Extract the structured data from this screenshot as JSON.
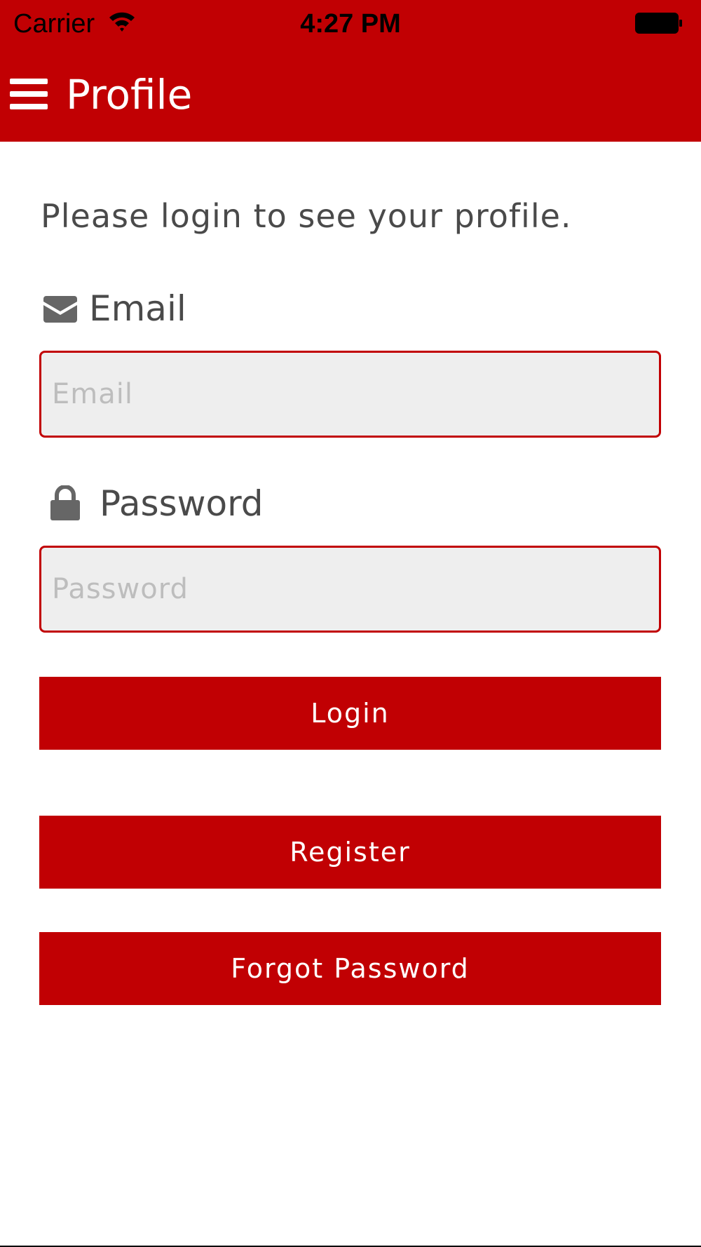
{
  "status_bar": {
    "carrier": "Carrier",
    "time": "4:27 PM",
    "wifi_icon": "wifi-icon",
    "battery_icon": "battery-icon"
  },
  "header": {
    "menu_icon": "hamburger-menu-icon",
    "title": "Profile",
    "background_color": "#c10003"
  },
  "main": {
    "prompt": "Please login to see your profile.",
    "email": {
      "icon": "envelope-icon",
      "label": "Email",
      "value": "",
      "placeholder": "Email"
    },
    "password": {
      "icon": "lock-icon",
      "label": "Password",
      "value": "",
      "placeholder": "Password"
    },
    "buttons": {
      "login": "Login",
      "register": "Register",
      "forgot_password": "Forgot Password"
    }
  },
  "colors": {
    "accent": "#c10003",
    "input_background": "#eeeeee",
    "text": "#4a4a4a",
    "placeholder": "#bdbdbd"
  }
}
